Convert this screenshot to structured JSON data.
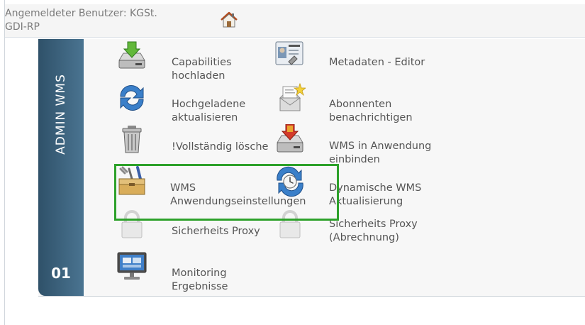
{
  "header": {
    "user_line1": "Angemeldeter Benutzer: KGSt.",
    "user_line2": "GDI-RP",
    "home_icon": "home-icon"
  },
  "sidebar": {
    "title": "ADMIN WMS",
    "number": "01",
    "gradient": [
      "#2f5169",
      "#4a7491"
    ]
  },
  "items": [
    {
      "name": "capabilities-upload",
      "icon": "drive-download-icon",
      "line1": "Capabilities",
      "line2": "hochladen"
    },
    {
      "name": "metadata-editor",
      "icon": "id-card-icon",
      "line1": "Metadaten - Editor",
      "line2": ""
    },
    {
      "name": "update-uploaded",
      "icon": "refresh-icon",
      "line1": "Hochgeladene",
      "line2": "aktualisieren"
    },
    {
      "name": "notify-subscribers",
      "icon": "mail-star-icon",
      "line1": "Abonnenten",
      "line2": "benachrichtigen"
    },
    {
      "name": "delete-completely",
      "icon": "trash-icon",
      "line1": "!Vollständig lösche",
      "line2": ""
    },
    {
      "name": "wms-in-application",
      "icon": "drive-import-icon",
      "line1": "WMS in Anwendung",
      "line2": "einbinden"
    },
    {
      "name": "wms-app-settings",
      "icon": "toolbox-icon",
      "line1": "WMS",
      "line2": "Anwendungseinstellungen"
    },
    {
      "name": "dynamic-wms-update",
      "icon": "clock-refresh-icon",
      "line1": "Dynamische WMS",
      "line2": "Aktualisierung"
    },
    {
      "name": "security-proxy",
      "icon": "lock-icon",
      "line1": "Sicherheits Proxy",
      "line2": ""
    },
    {
      "name": "security-proxy-billing",
      "icon": "lock-icon",
      "line1": "Sicherheits Proxy",
      "line2": "(Abrechnung)"
    },
    {
      "name": "monitoring-results",
      "icon": "monitor-icon",
      "line1": "Monitoring",
      "line2": "Ergebnisse"
    }
  ],
  "highlight_color": "#2da12a"
}
